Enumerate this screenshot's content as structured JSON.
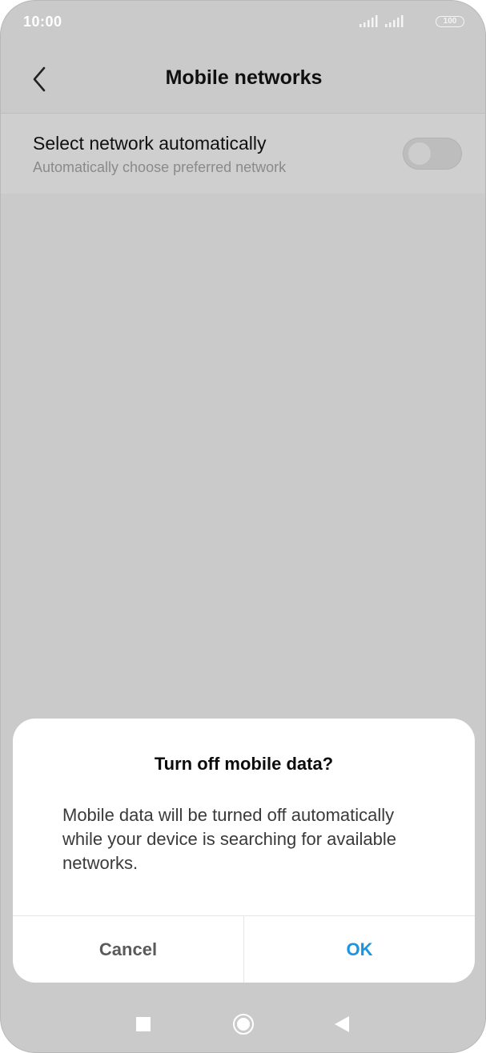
{
  "status_bar": {
    "time": "10:00",
    "battery_level": "100",
    "icons": [
      "signal-icon",
      "signal-icon",
      "battery-icon"
    ]
  },
  "header": {
    "title": "Mobile networks",
    "back_icon": "chevron-left-icon"
  },
  "settings": {
    "select_network": {
      "title": "Select network automatically",
      "subtitle": "Automatically choose preferred network",
      "toggle_on": false
    }
  },
  "dialog": {
    "title": "Turn off mobile data?",
    "message": "Mobile data will be turned off automatically while your device is searching for available networks.",
    "cancel_label": "Cancel",
    "ok_label": "OK",
    "ok_color": "#1b95e0"
  },
  "nav_bar": {
    "icons": [
      "recents-icon",
      "home-icon",
      "back-icon"
    ]
  },
  "colors": {
    "scrim": "#cacaca",
    "accent": "#1b95e0"
  }
}
